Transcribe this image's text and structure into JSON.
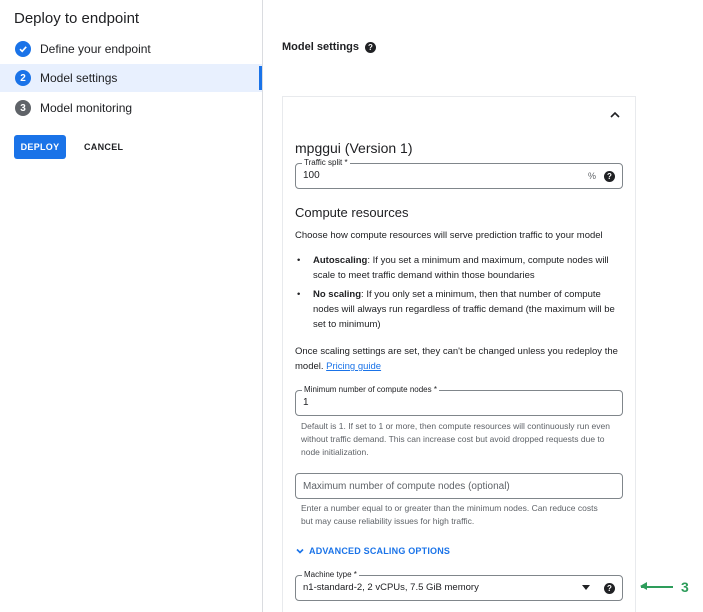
{
  "page": {
    "title": "Deploy to endpoint"
  },
  "steps": [
    {
      "label": "Define your endpoint",
      "state": "done",
      "icon": "check-icon"
    },
    {
      "label": "Model settings",
      "state": "current",
      "number": "2"
    },
    {
      "label": "Model monitoring",
      "state": "pending",
      "number": "3"
    }
  ],
  "actions": {
    "deploy_label": "DEPLOY",
    "cancel_label": "CANCEL"
  },
  "section": {
    "title": "Model settings",
    "help": "?"
  },
  "model": {
    "name": "mpggui (Version 1)"
  },
  "traffic_split": {
    "label": "Traffic split *",
    "value": "100",
    "suffix": "%"
  },
  "compute": {
    "heading": "Compute resources",
    "intro": "Choose how compute resources will serve prediction traffic to your model",
    "bullets": [
      {
        "term": "Autoscaling",
        "text": ": If you set a minimum and maximum, compute nodes will scale to meet traffic demand within those boundaries"
      },
      {
        "term": "No scaling",
        "text": ": If you only set a minimum, then that number of compute nodes will always run regardless of traffic demand (the maximum will be set to minimum)"
      }
    ],
    "note": "Once scaling settings are set, they can't be changed unless you redeploy the model.",
    "pricing_link": "Pricing guide"
  },
  "min_nodes": {
    "label": "Minimum number of compute nodes *",
    "value": "1",
    "hint": "Default is 1. If set to 1 or more, then compute resources will continuously run even without traffic demand. This can increase cost but avoid dropped requests due to node initialization."
  },
  "max_nodes": {
    "placeholder": "Maximum number of compute nodes (optional)",
    "hint": "Enter a number equal to or greater than the minimum nodes. Can reduce costs but may cause reliability issues for high traffic."
  },
  "advanced": {
    "label": "ADVANCED SCALING OPTIONS"
  },
  "machine_type": {
    "label": "Machine type *",
    "value": "n1-standard-2, 2 vCPUs, 7.5 GiB memory"
  },
  "annotation": {
    "number": "3"
  },
  "colors": {
    "accent": "#1a73e8",
    "annotation": "#2e9d5b",
    "border": "#80868b"
  }
}
